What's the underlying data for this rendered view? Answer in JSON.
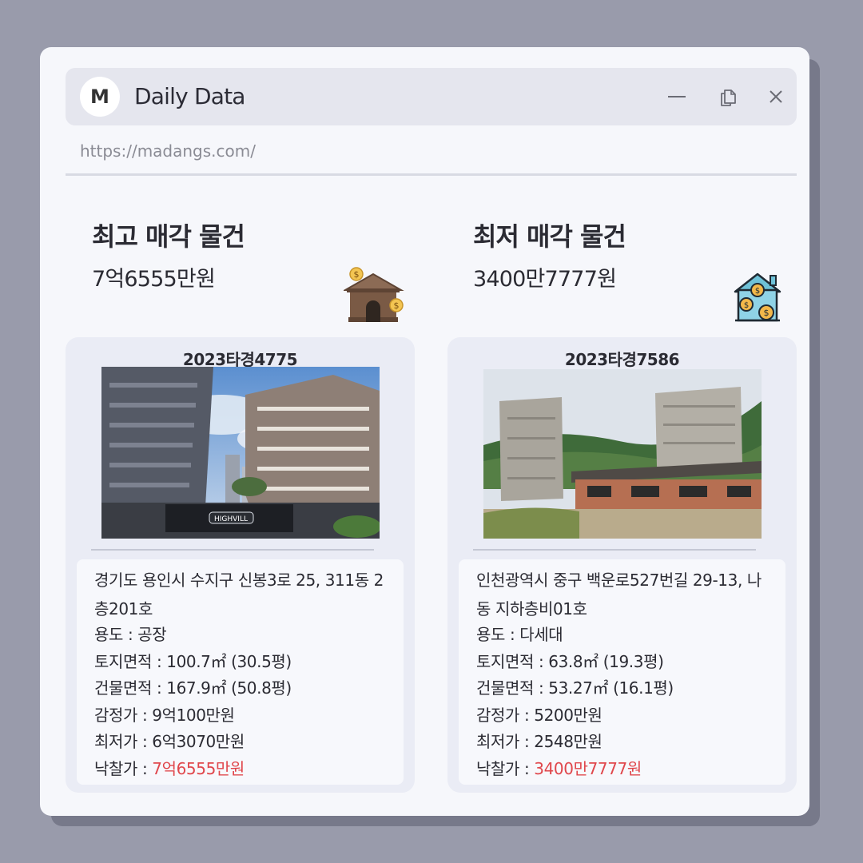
{
  "window": {
    "logo_letter": "M",
    "title": "Daily Data",
    "url": "https://madangs.com/"
  },
  "highest": {
    "heading": "최고 매각 물건",
    "price": "7억6555만원",
    "icon": "house-money-icon",
    "case_no": "2023타경4775",
    "photo": "apartment-towers-photo",
    "address": "경기도 용인시 수지구 신봉3로 25, 311동 2층201호",
    "usage": "용도 : 공장",
    "land_area": "토지면적 : 100.7㎡ (30.5평)",
    "building_area": "건물면적 : 167.9㎡ (50.8평)",
    "appraisal": "감정가 : 9억100만원",
    "minimum": "최저가 : 6억3070만원",
    "winning_label": "낙찰가 : ",
    "winning_value": "7억6555만원"
  },
  "lowest": {
    "heading": "최저 매각 물건",
    "price": "3400만7777원",
    "icon": "house-coins-icon",
    "case_no": "2023타경7586",
    "photo": "low-rise-buildings-photo",
    "address": "인천광역시 중구 백운로527번길 29-13, 나동 지하층비01호",
    "usage": "용도 : 다세대",
    "land_area": "토지면적 : 63.8㎡ (19.3평)",
    "building_area": "건물면적 : 53.27㎡ (16.1평)",
    "appraisal": "감정가 : 5200만원",
    "minimum": "최저가 : 2548만원",
    "winning_label": "낙찰가 : ",
    "winning_value": "3400만7777원"
  },
  "colors": {
    "background": "#999bab",
    "window": "#f6f7fb",
    "titlebar": "#e5e6ee",
    "card": "#eaecf5",
    "highlight": "#e0474c"
  }
}
